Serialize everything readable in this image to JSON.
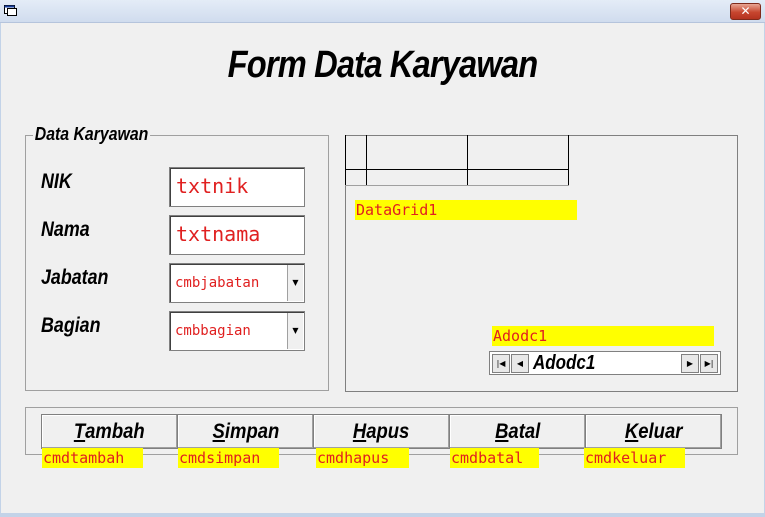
{
  "window": {
    "close_glyph": "✕"
  },
  "title": "Form Data Karyawan",
  "groupbox": {
    "caption": "Data Karyawan",
    "fields": [
      {
        "label": "NIK",
        "control": "txtnik"
      },
      {
        "label": "Nama",
        "control": "txtnama"
      },
      {
        "label": "Jabatan",
        "control": "cmbjabatan"
      },
      {
        "label": "Bagian",
        "control": "cmbbagian"
      }
    ]
  },
  "datagrid": {
    "label": "DataGrid1"
  },
  "adodc": {
    "label": "Adodc1",
    "caption": "Adodc1"
  },
  "buttons": [
    {
      "accel": "T",
      "rest": "ambah",
      "name": "cmdtambah"
    },
    {
      "accel": "S",
      "rest": "impan",
      "name": "cmdsimpan"
    },
    {
      "accel": "H",
      "rest": "apus",
      "name": "cmdhapus"
    },
    {
      "accel": "B",
      "rest": "atal",
      "name": "cmdbatal"
    },
    {
      "accel": "K",
      "rest": "eluar",
      "name": "cmdkeluar"
    }
  ],
  "icons": {
    "app": "app-form-icon",
    "close": "close-icon",
    "dropdown": "chevron-down-icon",
    "first": "first-record-icon",
    "prev": "previous-record-icon",
    "next": "next-record-icon",
    "last": "last-record-icon"
  },
  "colors": {
    "control_text": "#e02020",
    "label_highlight": "#ffff00",
    "close_button": "#c7462f"
  }
}
